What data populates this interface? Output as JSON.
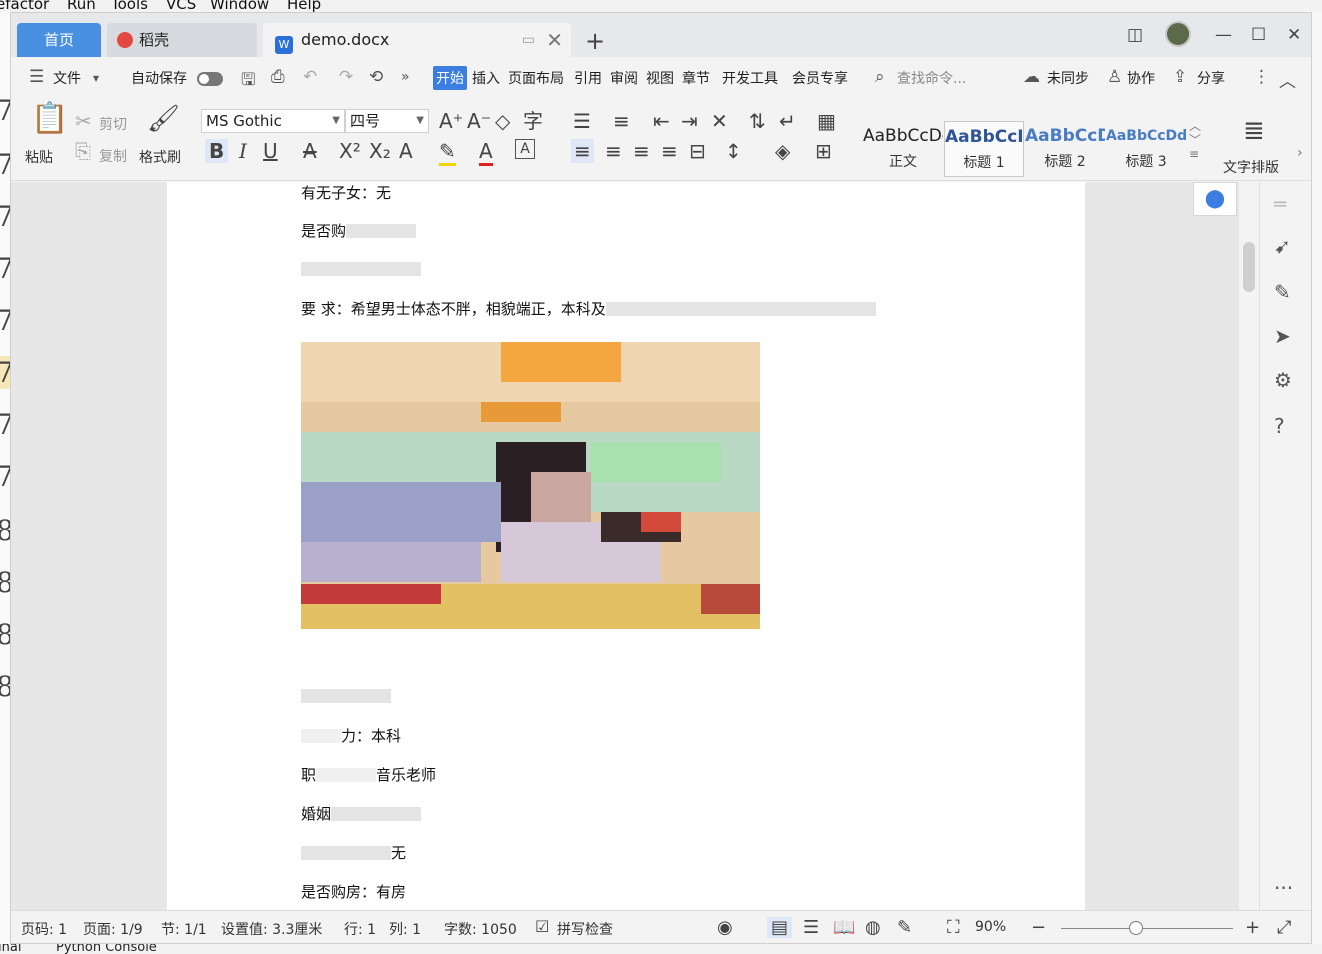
{
  "ide": {
    "menu": [
      "efactor",
      "Run",
      "Tools",
      "VCS",
      "Window",
      "Help"
    ],
    "gutter_digits": [
      "7",
      "7",
      "7",
      "7",
      "7",
      "7",
      "7",
      "7",
      "8",
      "8",
      "8",
      "8"
    ],
    "bottom": [
      "inal",
      "Python Console"
    ]
  },
  "tabs": {
    "home": "首页",
    "daoke": "稻壳",
    "doc": "demo.docx"
  },
  "menu": {
    "file": "文件",
    "autosave": "自动保存",
    "items": [
      "开始",
      "插入",
      "页面布局",
      "引用",
      "审阅",
      "视图",
      "章节",
      "开发工具",
      "会员专享"
    ],
    "search_placeholder": "查找命令...",
    "sync": "未同步",
    "collab": "协作",
    "share": "分享"
  },
  "ribbon": {
    "paste": "粘贴",
    "cut": "剪切",
    "copy": "复制",
    "format_painter": "格式刷",
    "font": "MS Gothic",
    "size": "四号",
    "styles": [
      {
        "sample": "AaBbCcDd",
        "label": "正文",
        "color": "#222222"
      },
      {
        "sample": "AaBbCcI",
        "label": "标题 1",
        "color": "#2f5597"
      },
      {
        "sample": "AaBbCcD",
        "label": "标题 2",
        "color": "#4a7cc4"
      },
      {
        "sample": "AaBbCcDd",
        "label": "标题 3",
        "color": "#4a7cc4"
      }
    ],
    "text_layout": "文字排版"
  },
  "document": {
    "line1": "有无子女：无",
    "line2": "是否购",
    "requirement": "要    求：希望男士体态不胖，相貌端正，本科及",
    "education": "力：本科",
    "job_prefix": "职",
    "job": "音乐老师",
    "marriage": "婚姻",
    "kids": "无",
    "house": "是否购房：有房"
  },
  "status": {
    "page_code": "页码: 1",
    "pages": "页面: 1/9",
    "section": "节: 1/1",
    "setting": "设置值: 3.3厘米",
    "row": "行: 1",
    "col": "列: 1",
    "words": "字数: 1050",
    "spell": "拼写检查",
    "zoom": "90%"
  },
  "colors": {
    "accent": "#3b7de0",
    "home_tab": "#4a90e2"
  }
}
